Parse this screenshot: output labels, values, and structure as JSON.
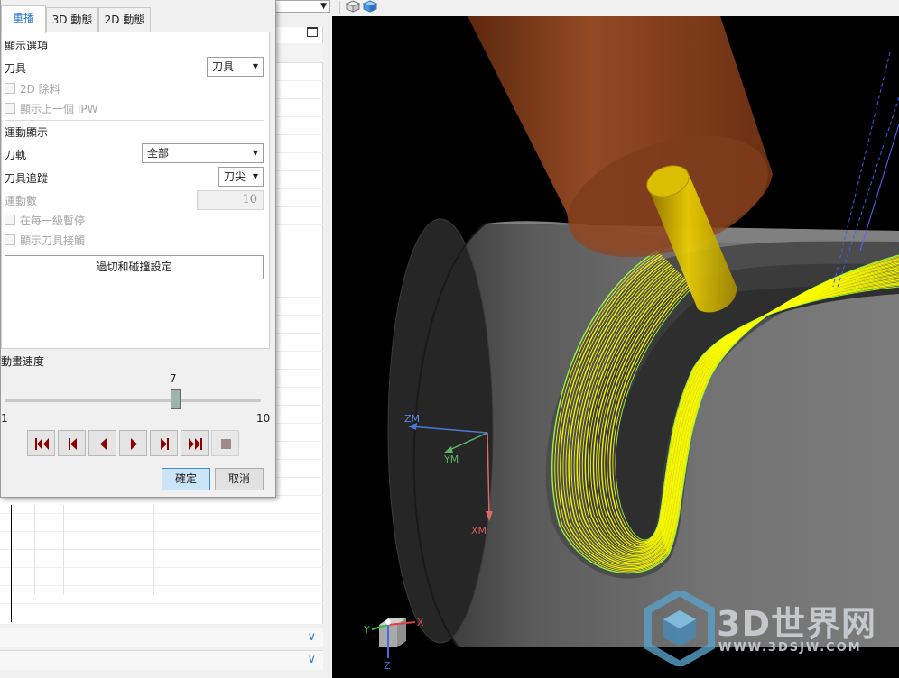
{
  "dialog": {
    "tabs": [
      {
        "label": "重播",
        "active": true
      },
      {
        "label": "3D 動態",
        "active": false
      },
      {
        "label": "2D 動態",
        "active": false
      }
    ],
    "display_options": {
      "section_title": "顯示選項",
      "tool_label": "刀具",
      "tool_value": "刀具",
      "removal_2d": "2D 除料",
      "show_prev_ipw": "顯示上一個 IPW"
    },
    "motion_display": {
      "section_title": "運動顯示",
      "toolpath_label": "刀軌",
      "toolpath_value": "全部",
      "tool_trace_label": "刀具追蹤",
      "tool_trace_value": "刀尖",
      "motion_count_label": "運動數",
      "motion_count_value": "10",
      "pause_each_level": "在每一級暫停",
      "show_tool_contact": "顯示刀具接觸"
    },
    "collision_button": "過切和碰撞設定",
    "animation_speed": {
      "label": "動畫速度",
      "value": "7",
      "min": "1",
      "max": "10",
      "level": 7
    },
    "playback_buttons": [
      {
        "name": "rewind-to-start-button",
        "icon": "skip-to-start-icon"
      },
      {
        "name": "step-backward-button",
        "icon": "step-back-icon"
      },
      {
        "name": "play-reverse-button",
        "icon": "play-reverse-icon"
      },
      {
        "name": "play-forward-button",
        "icon": "play-icon"
      },
      {
        "name": "step-forward-button",
        "icon": "step-forward-icon"
      },
      {
        "name": "fast-forward-to-end-button",
        "icon": "skip-to-end-icon"
      },
      {
        "name": "stop-button",
        "icon": "stop-icon"
      }
    ],
    "ok_button": "確定",
    "cancel_button": "取消"
  },
  "viewport": {
    "background": "#000000",
    "part_color": "#6e6e6e",
    "toolpath_color": "#ffff00",
    "holder_color": "#9a4a20",
    "tool_color": "#d6b800",
    "wcs_axes": {
      "zm": "ZM",
      "ym": "YM",
      "xm": "XM"
    },
    "triad": {
      "x": "X",
      "y": "Y",
      "z": "Z"
    }
  },
  "watermark": {
    "text": "3D世界网",
    "url": "WWW.3DSJW.COM"
  },
  "colors": {
    "accent": "#2a7bd6",
    "ok_button_bg": "#cce4f7",
    "playback_icon": "#8b0000"
  }
}
